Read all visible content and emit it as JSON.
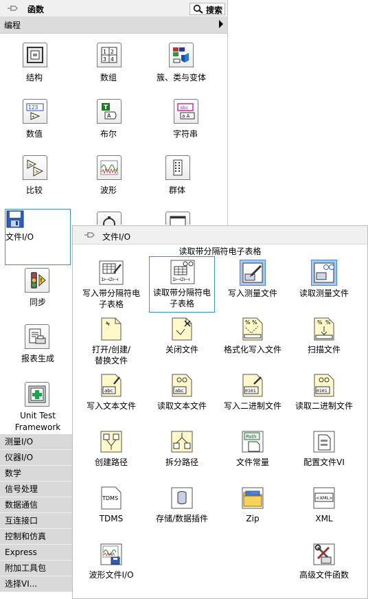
{
  "palette": {
    "title": "函数",
    "search_label": "搜索",
    "category": "编程",
    "tiles": [
      {
        "label": "结构"
      },
      {
        "label": "数组"
      },
      {
        "label": "簇、类与变体"
      },
      {
        "label": "数值"
      },
      {
        "label": "布尔"
      },
      {
        "label": "字符串"
      },
      {
        "label": "比较"
      },
      {
        "label": "波形"
      },
      {
        "label": "群体"
      },
      {
        "label": "文件I/O"
      },
      {
        "label": "同步"
      },
      {
        "label": "报表生成"
      },
      {
        "label": "Unit Test Framework",
        "line1": "Unit Test",
        "line2": "Framework"
      }
    ],
    "categories": [
      "测量I/O",
      "仪器I/O",
      "数学",
      "信号处理",
      "数据通信",
      "互连接口",
      "控制和仿真",
      "Express",
      "附加工具包",
      "选择VI..."
    ]
  },
  "file_io": {
    "title": "文件I/O",
    "tooltip": "读取带分隔符电子表格",
    "items": [
      {
        "label": "写入带分隔符电子表格",
        "line1": "写入带分隔符电",
        "line2": "子表格"
      },
      {
        "label": "读取带分隔符电子表格",
        "line1": "读取带分隔符电",
        "line2": "子表格"
      },
      {
        "label": "写入测量文件"
      },
      {
        "label": "读取测量文件"
      },
      {
        "label": "打开/创建/替换文件",
        "line1": "打开/创建/",
        "line2": "替换文件"
      },
      {
        "label": "关闭文件"
      },
      {
        "label": "格式化写入文件"
      },
      {
        "label": "扫描文件"
      },
      {
        "label": "写入文本文件"
      },
      {
        "label": "读取文本文件"
      },
      {
        "label": "写入二进制文件"
      },
      {
        "label": "读取二进制文件"
      },
      {
        "label": "创建路径"
      },
      {
        "label": "拆分路径"
      },
      {
        "label": "文件常量"
      },
      {
        "label": "配置文件VI"
      },
      {
        "label": "TDMS"
      },
      {
        "label": "存储/数据插件"
      },
      {
        "label": "Zip"
      },
      {
        "label": "XML"
      },
      {
        "label": "波形文件I/O"
      },
      {
        "label": "高级文件函数"
      }
    ],
    "icon_text": {
      "tdms": "TDMS",
      "xml": "<XML>",
      "path": "Path",
      "abc": "abc",
      "binary": "0101",
      "numeric": "123",
      "string": "abc",
      "t": "T"
    }
  },
  "colors": {
    "selection": "#3b8ed6",
    "highlight": "#a9c7ee",
    "category_bg": "#d9d9d9",
    "file_icon": "#fff8c8"
  }
}
